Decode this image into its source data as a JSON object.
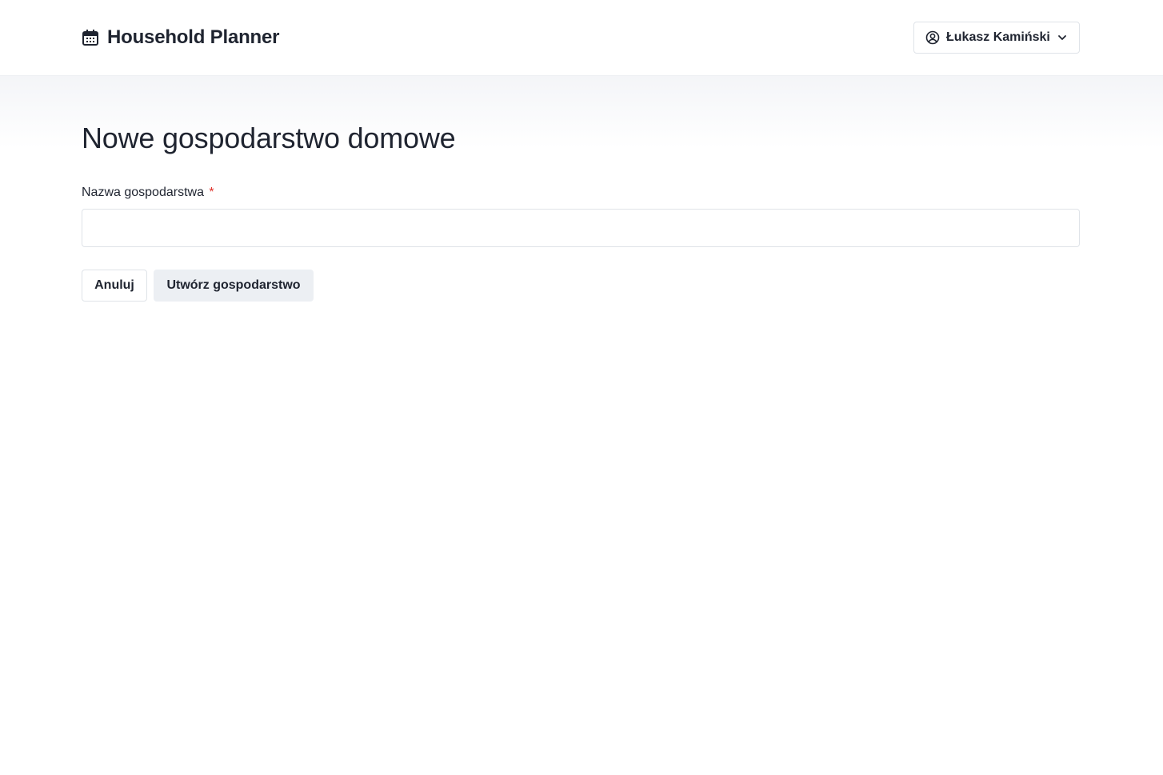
{
  "header": {
    "brand_icon": "calendar-icon",
    "title": "Household Planner",
    "user_menu": {
      "icon": "user-circle-icon",
      "name": "Łukasz Kamiński",
      "chevron_icon": "chevron-down-icon"
    }
  },
  "main": {
    "page_title": "Nowe gospodarstwo domowe",
    "form": {
      "name_label": "Nazwa gospodarstwa",
      "required_mark": "*",
      "name_value": "",
      "name_placeholder": ""
    },
    "actions": {
      "cancel_label": "Anuluj",
      "create_label": "Utwórz gospodarstwo"
    }
  },
  "colors": {
    "text": "#1f2430",
    "required": "#e0322b",
    "border": "#dfe3e8",
    "secondary_button_bg": "#eceff3",
    "header_bg": "#ffffff",
    "page_gradient_top": "#f4f5f8"
  }
}
